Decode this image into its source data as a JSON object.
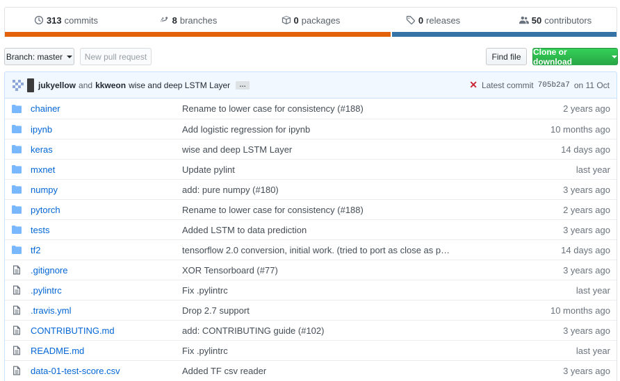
{
  "stats": {
    "commits": {
      "count": "313",
      "label": "commits",
      "icon": "history-icon"
    },
    "branches": {
      "count": "8",
      "label": "branches",
      "icon": "git-branch-icon"
    },
    "packages": {
      "count": "0",
      "label": "packages",
      "icon": "package-icon"
    },
    "releases": {
      "count": "0",
      "label": "releases",
      "icon": "tag-icon"
    },
    "contributors": {
      "count": "50",
      "label": "contributors",
      "icon": "people-icon"
    }
  },
  "language_bar": [
    {
      "color": "#e36209",
      "fraction": 0.632
    },
    {
      "color": "#3572a5",
      "fraction": 0.368
    }
  ],
  "toolbar": {
    "branch_label": "Branch: master",
    "new_pr_label": "New pull request",
    "find_file_label": "Find file",
    "clone_label": "Clone or download"
  },
  "commit": {
    "author1": "jukyellow",
    "and": "and",
    "author2": "kkweon",
    "message": "wise and deep LSTM Layer",
    "ellipsis": "…",
    "status_icon": "x-icon",
    "latest_label": "Latest commit",
    "sha": "705b2a7",
    "date": "on 11 Oct"
  },
  "files": [
    {
      "type": "dir",
      "name": "chainer",
      "message": "Rename to lower case for consistency (#188)",
      "age": "2 years ago"
    },
    {
      "type": "dir",
      "name": "ipynb",
      "message": "Add logistic regression for ipynb",
      "age": "10 months ago"
    },
    {
      "type": "dir",
      "name": "keras",
      "message": "wise and deep LSTM Layer",
      "age": "14 days ago"
    },
    {
      "type": "dir",
      "name": "mxnet",
      "message": "Update pylint",
      "age": "last year"
    },
    {
      "type": "dir",
      "name": "numpy",
      "message": "add: pure numpy (#180)",
      "age": "3 years ago"
    },
    {
      "type": "dir",
      "name": "pytorch",
      "message": "Rename to lower case for consistency (#188)",
      "age": "2 years ago"
    },
    {
      "type": "dir",
      "name": "tests",
      "message": "Added LSTM to data prediction",
      "age": "3 years ago"
    },
    {
      "type": "dir",
      "name": "tf2",
      "message": "tensorflow 2.0 conversion, initial work. (tried to port as close as p…",
      "age": "14 days ago"
    },
    {
      "type": "file",
      "name": ".gitignore",
      "message": "XOR Tensorboard (#77)",
      "age": "3 years ago"
    },
    {
      "type": "file",
      "name": ".pylintrc",
      "message": "Fix .pylintrc",
      "age": "last year"
    },
    {
      "type": "file",
      "name": ".travis.yml",
      "message": "Drop 2.7 support",
      "age": "10 months ago"
    },
    {
      "type": "file",
      "name": "CONTRIBUTING.md",
      "message": "add: CONTRIBUTING guide (#102)",
      "age": "3 years ago"
    },
    {
      "type": "file",
      "name": "README.md",
      "message": "Fix .pylintrc",
      "age": "last year"
    },
    {
      "type": "file",
      "name": "data-01-test-score.csv",
      "message": "Added TF csv reader",
      "age": "3 years ago"
    }
  ],
  "colors": {
    "link": "#0366d6",
    "folder_icon": "#79b8ff",
    "file_icon": "#6a737d",
    "tease_bg": "#f1f8ff",
    "clone_button": "#28a745"
  }
}
